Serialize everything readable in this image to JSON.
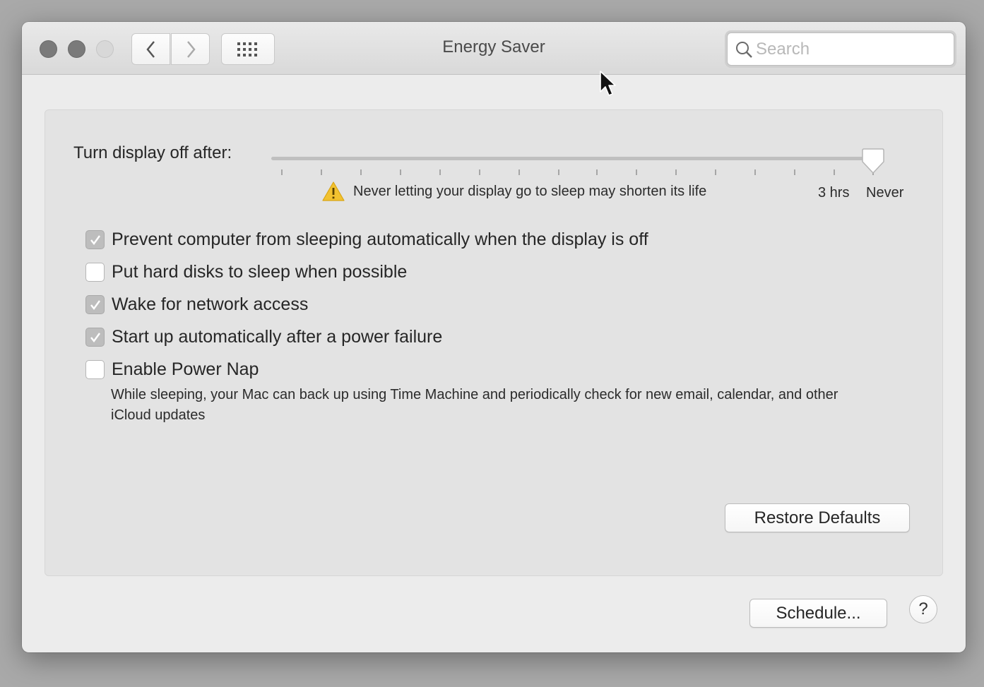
{
  "window": {
    "title": "Energy Saver"
  },
  "toolbar": {
    "back_icon": "chevron-left-icon",
    "forward_icon": "chevron-right-icon",
    "grid_icon": "grid-icon",
    "search_placeholder": "Search"
  },
  "display_sleep": {
    "label": "Turn display off after:",
    "value": "Never",
    "warning": "Never letting your display go to sleep may shorten its life",
    "tick_labels": [
      "3 hrs",
      "Never"
    ]
  },
  "options": [
    {
      "label": "Prevent computer from sleeping automatically when the display is off",
      "checked": true
    },
    {
      "label": "Put hard disks to sleep when possible",
      "checked": false
    },
    {
      "label": "Wake for network access",
      "checked": true
    },
    {
      "label": "Start up automatically after a power failure",
      "checked": true
    },
    {
      "label": "Enable Power Nap",
      "checked": false
    }
  ],
  "power_nap_description": "While sleeping, your Mac can back up using Time Machine and periodically check for new email, calendar, and other iCloud updates",
  "buttons": {
    "restore_defaults": "Restore Defaults",
    "schedule": "Schedule...",
    "help": "?"
  },
  "colors": {
    "window_bg": "#ececec",
    "panel_bg": "#e3e3e3",
    "warning_yellow": "#f2c230"
  }
}
